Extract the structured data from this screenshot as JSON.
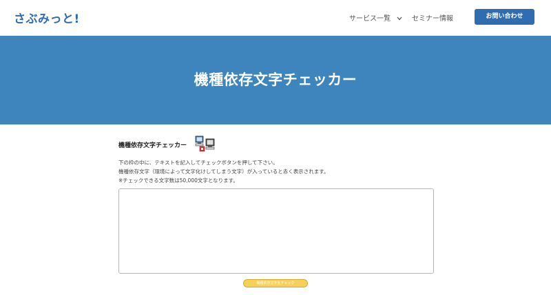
{
  "header": {
    "logo": "さぶみっと!",
    "nav": {
      "services": "サービス一覧",
      "seminar": "セミナー情報"
    },
    "contact_button": "お問い合わせ"
  },
  "hero": {
    "title": "機種依存文字チェッカー"
  },
  "tool": {
    "heading": "機種依存文字チェッカー",
    "icon": "computers-icon",
    "descriptions": [
      "下の枠の中に、テキストを記入してチェックボタンを押して下さい。",
      "機種依存文字（環境によって文字化けしてしまう文字）が入っていると赤く表示されます。",
      "※チェックできる文字数は50,000文字となります。"
    ],
    "textarea_value": "",
    "check_button": "機種依存文字をチェック"
  },
  "colors": {
    "brand": "#2f6db0",
    "hero_bg": "#3e85bd",
    "button_yellow": "#f6d15a"
  }
}
